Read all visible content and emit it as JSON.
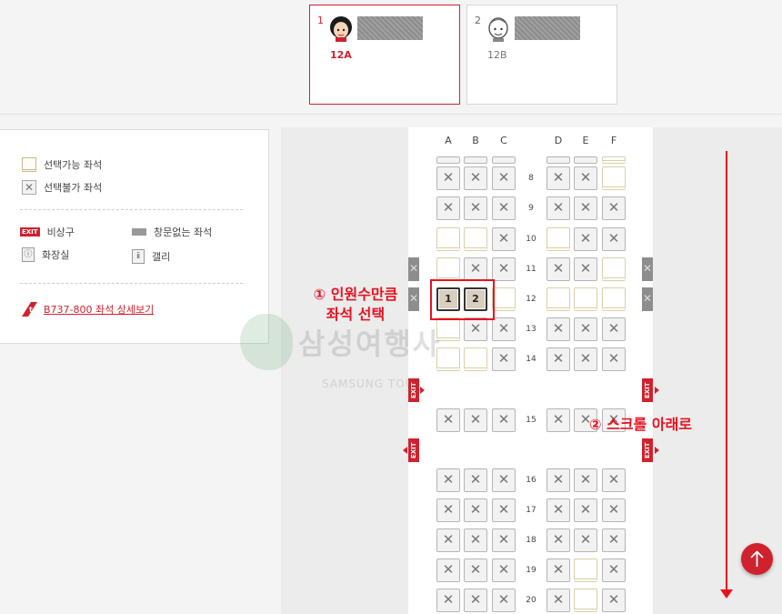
{
  "passengers": [
    {
      "num": "1",
      "seat": "12A",
      "active": true
    },
    {
      "num": "2",
      "seat": "12B",
      "active": false
    }
  ],
  "legend": {
    "available": "선택가능 좌석",
    "unavailable": "선택불가 좌석",
    "exit_badge": "EXIT",
    "exit": "비상구",
    "no_window": "창문없는 좌석",
    "restroom": "화장실",
    "galley": "갤리",
    "detail_link": "B737-800 좌석 상세보기"
  },
  "seatmap": {
    "columns": [
      "A",
      "B",
      "C",
      "D",
      "E",
      "F"
    ],
    "exit_label": "EXIT",
    "rows": [
      {
        "num": "",
        "seats": [
          "x-top",
          "x-top",
          "x-top",
          "x-top",
          "x-top",
          "a-top"
        ]
      },
      {
        "num": "8",
        "seats": [
          "x",
          "x",
          "x",
          "x",
          "x",
          "a"
        ]
      },
      {
        "num": "9",
        "seats": [
          "x",
          "x",
          "x",
          "x",
          "x",
          "x"
        ]
      },
      {
        "num": "10",
        "seats": [
          "a",
          "a",
          "x",
          "a",
          "x",
          "x"
        ]
      },
      {
        "num": "11",
        "seats": [
          "a",
          "x",
          "x",
          "x",
          "x",
          "a"
        ]
      },
      {
        "num": "12",
        "seats": [
          "s1",
          "s2",
          "a",
          "a",
          "a",
          "a"
        ]
      },
      {
        "num": "13",
        "seats": [
          "a",
          "x",
          "x",
          "x",
          "x",
          "x"
        ]
      },
      {
        "num": "14",
        "seats": [
          "a",
          "a",
          "x",
          "x",
          "x",
          "x"
        ]
      },
      {
        "num": "15",
        "seats": [
          "x",
          "x",
          "x",
          "x",
          "x",
          "x"
        ]
      },
      {
        "num": "16",
        "seats": [
          "x",
          "x",
          "x",
          "x",
          "x",
          "x"
        ]
      },
      {
        "num": "17",
        "seats": [
          "x",
          "x",
          "x",
          "x",
          "x",
          "x"
        ]
      },
      {
        "num": "18",
        "seats": [
          "x",
          "x",
          "x",
          "x",
          "x",
          "x"
        ]
      },
      {
        "num": "19",
        "seats": [
          "x",
          "x",
          "x",
          "x",
          "a",
          "x"
        ]
      },
      {
        "num": "20",
        "seats": [
          "x",
          "x",
          "x",
          "x",
          "a",
          "x"
        ]
      }
    ],
    "selected_labels": {
      "s1": "1",
      "s2": "2"
    }
  },
  "annotations": {
    "step1_line1": "① 인원수만큼",
    "step1_line2": "좌석 선택",
    "step2": "② 스크롤 아래로"
  },
  "watermark": {
    "name": "삼성여행사",
    "sub": "SAMSUNG TOUR"
  },
  "colors": {
    "accent": "#d0212f",
    "annotation": "#e8121f"
  }
}
